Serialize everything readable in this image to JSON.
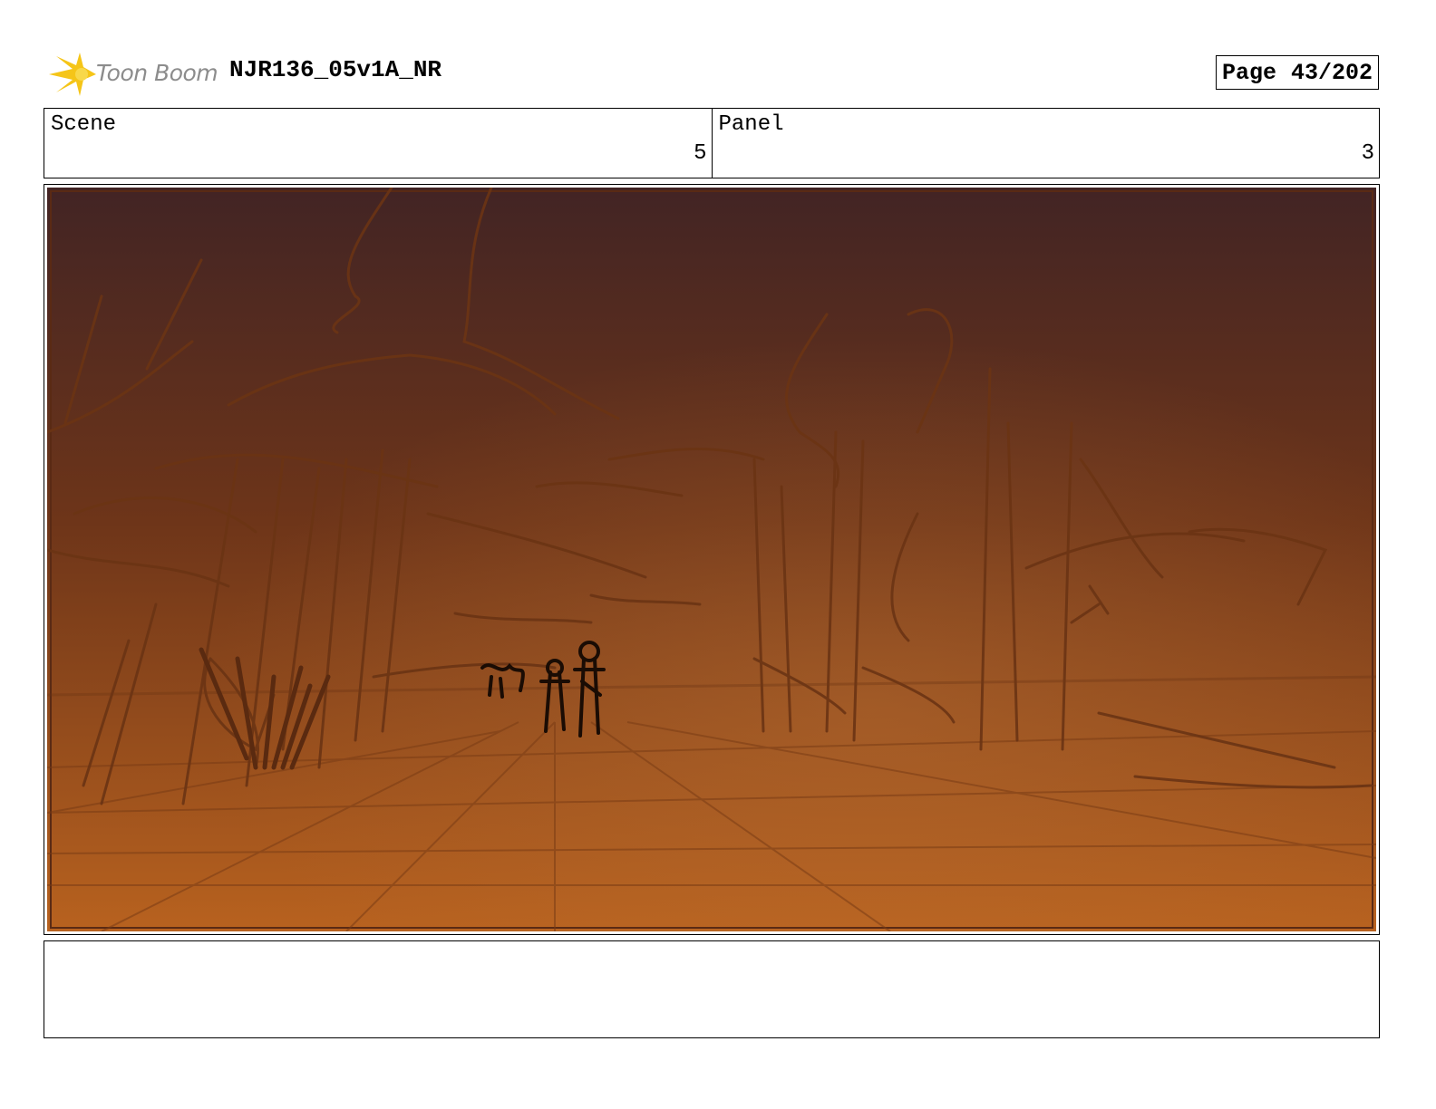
{
  "header": {
    "logo_text": "Toon Boom",
    "project_title": "NJR136_05v1A_NR",
    "page_label": "Page",
    "page_number": "43/202"
  },
  "info": {
    "scene_label": "Scene",
    "scene_value": "5",
    "panel_label": "Panel",
    "panel_value": "3"
  },
  "notes": {
    "text": ""
  },
  "colors": {
    "sky_top": "#422424",
    "ground_bottom": "#b8621f",
    "sketch_line": "#6b3414",
    "logo_yellow": "#f5c518"
  }
}
